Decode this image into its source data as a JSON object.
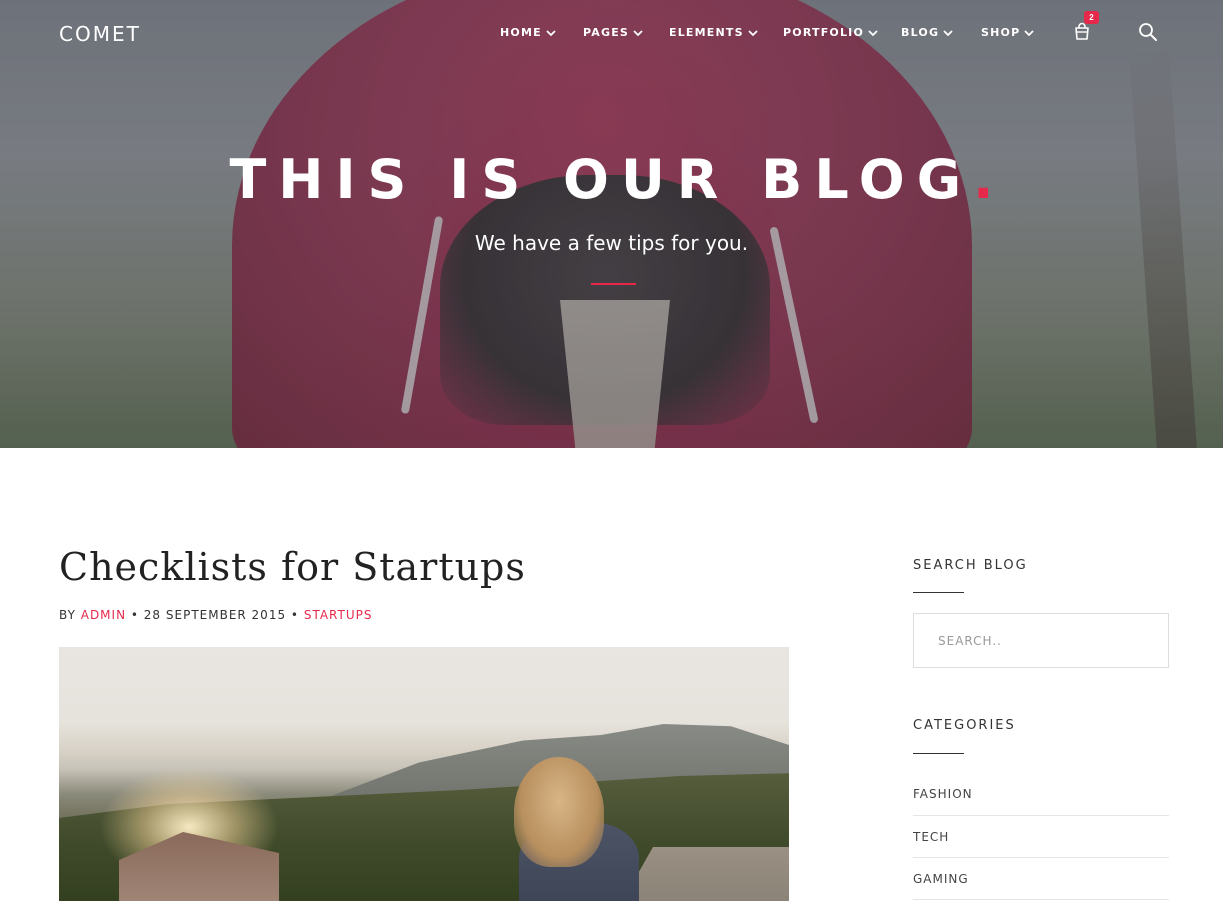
{
  "brand": {
    "logo": "COMET",
    "accent_color": "#e6294b"
  },
  "nav": {
    "items": [
      {
        "label": "HOME"
      },
      {
        "label": "PAGES"
      },
      {
        "label": "ELEMENTS"
      },
      {
        "label": "PORTFOLIO"
      },
      {
        "label": "BLOG"
      },
      {
        "label": "SHOP"
      }
    ],
    "cart_icon": "cart-icon",
    "cart_count": "2",
    "search_icon": "search-icon"
  },
  "hero": {
    "title": "THIS IS OUR BLOG",
    "title_dot": ".",
    "subtitle": "We have a few tips for you."
  },
  "post": {
    "title": "Checklists for Startups",
    "by_label": "BY",
    "author": "ADMIN",
    "date": "28 SEPTEMBER 2015",
    "category": "STARTUPS",
    "separator": "•"
  },
  "sidebar": {
    "search": {
      "title": "SEARCH BLOG",
      "placeholder": "SEARCH.."
    },
    "categories": {
      "title": "CATEGORIES",
      "items": [
        {
          "label": "FASHION"
        },
        {
          "label": "TECH"
        },
        {
          "label": "GAMING"
        }
      ]
    }
  }
}
